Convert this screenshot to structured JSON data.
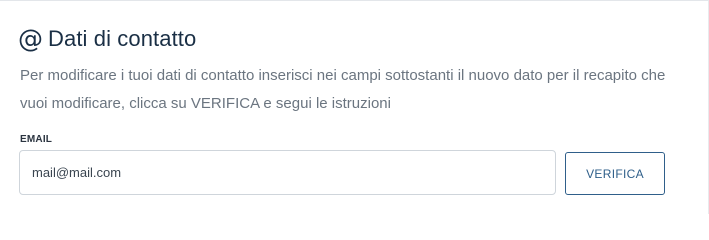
{
  "section": {
    "icon": "at-sign-icon",
    "icon_glyph": "@",
    "title": "Dati di contatto",
    "description": "Per modificare i tuoi dati di contatto inserisci nei campi sottostanti il nuovo dato per il recapito che vuoi modificare, clicca su VERIFICA e segui le istruzioni"
  },
  "email_field": {
    "label": "EMAIL",
    "value": "mail@mail.com"
  },
  "verify_button": {
    "label": "VERIFICA"
  },
  "colors": {
    "title": "#1a2f45",
    "description": "#6b7580",
    "button_border": "#2f5f8a",
    "input_border": "#cfd5db"
  }
}
